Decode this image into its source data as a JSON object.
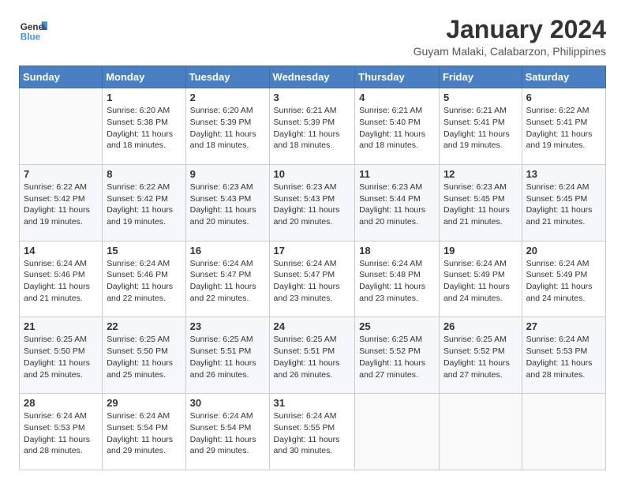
{
  "logo": {
    "line1": "General",
    "line2": "Blue",
    "icon_color": "#4a90d9"
  },
  "title": "January 2024",
  "subtitle": "Guyam Malaki, Calabarzon, Philippines",
  "header_days": [
    "Sunday",
    "Monday",
    "Tuesday",
    "Wednesday",
    "Thursday",
    "Friday",
    "Saturday"
  ],
  "weeks": [
    [
      {
        "day": "",
        "info": ""
      },
      {
        "day": "1",
        "info": "Sunrise: 6:20 AM\nSunset: 5:38 PM\nDaylight: 11 hours\nand 18 minutes."
      },
      {
        "day": "2",
        "info": "Sunrise: 6:20 AM\nSunset: 5:39 PM\nDaylight: 11 hours\nand 18 minutes."
      },
      {
        "day": "3",
        "info": "Sunrise: 6:21 AM\nSunset: 5:39 PM\nDaylight: 11 hours\nand 18 minutes."
      },
      {
        "day": "4",
        "info": "Sunrise: 6:21 AM\nSunset: 5:40 PM\nDaylight: 11 hours\nand 18 minutes."
      },
      {
        "day": "5",
        "info": "Sunrise: 6:21 AM\nSunset: 5:41 PM\nDaylight: 11 hours\nand 19 minutes."
      },
      {
        "day": "6",
        "info": "Sunrise: 6:22 AM\nSunset: 5:41 PM\nDaylight: 11 hours\nand 19 minutes."
      }
    ],
    [
      {
        "day": "7",
        "info": "Sunrise: 6:22 AM\nSunset: 5:42 PM\nDaylight: 11 hours\nand 19 minutes."
      },
      {
        "day": "8",
        "info": "Sunrise: 6:22 AM\nSunset: 5:42 PM\nDaylight: 11 hours\nand 19 minutes."
      },
      {
        "day": "9",
        "info": "Sunrise: 6:23 AM\nSunset: 5:43 PM\nDaylight: 11 hours\nand 20 minutes."
      },
      {
        "day": "10",
        "info": "Sunrise: 6:23 AM\nSunset: 5:43 PM\nDaylight: 11 hours\nand 20 minutes."
      },
      {
        "day": "11",
        "info": "Sunrise: 6:23 AM\nSunset: 5:44 PM\nDaylight: 11 hours\nand 20 minutes."
      },
      {
        "day": "12",
        "info": "Sunrise: 6:23 AM\nSunset: 5:45 PM\nDaylight: 11 hours\nand 21 minutes."
      },
      {
        "day": "13",
        "info": "Sunrise: 6:24 AM\nSunset: 5:45 PM\nDaylight: 11 hours\nand 21 minutes."
      }
    ],
    [
      {
        "day": "14",
        "info": "Sunrise: 6:24 AM\nSunset: 5:46 PM\nDaylight: 11 hours\nand 21 minutes."
      },
      {
        "day": "15",
        "info": "Sunrise: 6:24 AM\nSunset: 5:46 PM\nDaylight: 11 hours\nand 22 minutes."
      },
      {
        "day": "16",
        "info": "Sunrise: 6:24 AM\nSunset: 5:47 PM\nDaylight: 11 hours\nand 22 minutes."
      },
      {
        "day": "17",
        "info": "Sunrise: 6:24 AM\nSunset: 5:47 PM\nDaylight: 11 hours\nand 23 minutes."
      },
      {
        "day": "18",
        "info": "Sunrise: 6:24 AM\nSunset: 5:48 PM\nDaylight: 11 hours\nand 23 minutes."
      },
      {
        "day": "19",
        "info": "Sunrise: 6:24 AM\nSunset: 5:49 PM\nDaylight: 11 hours\nand 24 minutes."
      },
      {
        "day": "20",
        "info": "Sunrise: 6:24 AM\nSunset: 5:49 PM\nDaylight: 11 hours\nand 24 minutes."
      }
    ],
    [
      {
        "day": "21",
        "info": "Sunrise: 6:25 AM\nSunset: 5:50 PM\nDaylight: 11 hours\nand 25 minutes."
      },
      {
        "day": "22",
        "info": "Sunrise: 6:25 AM\nSunset: 5:50 PM\nDaylight: 11 hours\nand 25 minutes."
      },
      {
        "day": "23",
        "info": "Sunrise: 6:25 AM\nSunset: 5:51 PM\nDaylight: 11 hours\nand 26 minutes."
      },
      {
        "day": "24",
        "info": "Sunrise: 6:25 AM\nSunset: 5:51 PM\nDaylight: 11 hours\nand 26 minutes."
      },
      {
        "day": "25",
        "info": "Sunrise: 6:25 AM\nSunset: 5:52 PM\nDaylight: 11 hours\nand 27 minutes."
      },
      {
        "day": "26",
        "info": "Sunrise: 6:25 AM\nSunset: 5:52 PM\nDaylight: 11 hours\nand 27 minutes."
      },
      {
        "day": "27",
        "info": "Sunrise: 6:24 AM\nSunset: 5:53 PM\nDaylight: 11 hours\nand 28 minutes."
      }
    ],
    [
      {
        "day": "28",
        "info": "Sunrise: 6:24 AM\nSunset: 5:53 PM\nDaylight: 11 hours\nand 28 minutes."
      },
      {
        "day": "29",
        "info": "Sunrise: 6:24 AM\nSunset: 5:54 PM\nDaylight: 11 hours\nand 29 minutes."
      },
      {
        "day": "30",
        "info": "Sunrise: 6:24 AM\nSunset: 5:54 PM\nDaylight: 11 hours\nand 29 minutes."
      },
      {
        "day": "31",
        "info": "Sunrise: 6:24 AM\nSunset: 5:55 PM\nDaylight: 11 hours\nand 30 minutes."
      },
      {
        "day": "",
        "info": ""
      },
      {
        "day": "",
        "info": ""
      },
      {
        "day": "",
        "info": ""
      }
    ]
  ]
}
